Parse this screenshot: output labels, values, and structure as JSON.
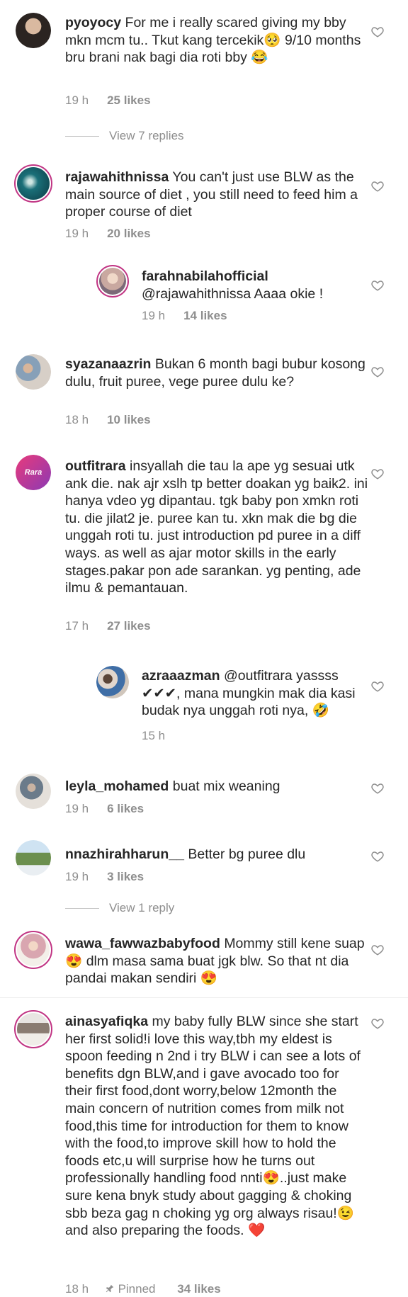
{
  "comments": [
    {
      "user": "pyoyocy",
      "text": "For me i really scared giving my bby mkn mcm tu.. Tkut kang tercekik🥺 9/10 months bru brani nak bagi dia roti bby 😂",
      "time": "19 h",
      "likes": "25 likes"
    },
    {
      "user": "rajawahithnissa",
      "text": "You can't just use BLW as the main source of diet , you still need to feed him a proper course of diet",
      "time": "19 h",
      "likes": "20 likes"
    },
    {
      "user": "farahnabilahofficial",
      "text": "@rajawahithnissa Aaaa okie !",
      "time": "19 h",
      "likes": "14 likes"
    },
    {
      "user": "syazanaazrin",
      "text": "Bukan 6 month bagi bubur kosong dulu, fruit puree, vege puree dulu ke?",
      "time": "18 h",
      "likes": "10 likes"
    },
    {
      "user": "outfitrara",
      "text": "insyallah die tau la ape yg sesuai utk ank die. nak ajr xslh tp better doakan yg baik2. ini hanya vdeo yg dipantau. tgk baby pon xmkn roti tu. die jilat2 je. puree kan tu. xkn mak die bg die unggah roti tu. just introduction pd puree in a diff ways. as well as ajar motor skills in the early stages.pakar pon ade sarankan. yg penting, ade ilmu & pemantauan.",
      "time": "17 h",
      "likes": "27 likes"
    },
    {
      "user": "azraaazman",
      "text": "@outfitrara yassss ✔✔✔, mana mungkin mak dia kasi budak nya unggah roti nya, 🤣",
      "time": "15 h",
      "likes": ""
    },
    {
      "user": "leyla_mohamed",
      "text": "buat mix weaning",
      "time": "19 h",
      "likes": "6 likes"
    },
    {
      "user": "nnazhirahharun__",
      "text": "Better bg puree dlu",
      "time": "19 h",
      "likes": "3 likes"
    },
    {
      "user": "wawa_fawwazbabyfood",
      "text": "Mommy still kene suap😍 dlm masa sama buat jgk blw. So that nt dia pandai makan sendiri 😍",
      "time": "",
      "likes": ""
    },
    {
      "user": "ainasyafiqka",
      "text": "my baby fully BLW since she start her first solid!i love this way,tbh my eldest is spoon feeding n 2nd i try BLW i can see a lots of benefits dgn BLW,and i gave avocado too for their first food,dont worry,below 12month the main concern of nutrition comes from milk not food,this time for introduction for them to know with the food,to improve skill how to hold the foods etc,u will surprise how he turns out professionally handling food nnti😍..just make sure kena bnyk study about gagging & choking sbb beza gag n choking yg org always risau!😉 and also preparing the foods. ❤️",
      "time": "18 h",
      "likes": "34 likes",
      "pinned": "Pinned"
    }
  ],
  "view_replies_1": "View 7 replies",
  "view_replies_2": "View 1 reply",
  "icons": {
    "heart": "heart-outline-icon",
    "pin": "pin-icon"
  },
  "colors": {
    "text": "#262626",
    "muted": "#8e8e8e",
    "story_ring": "#c13584",
    "heart_red": "#e0245e"
  }
}
